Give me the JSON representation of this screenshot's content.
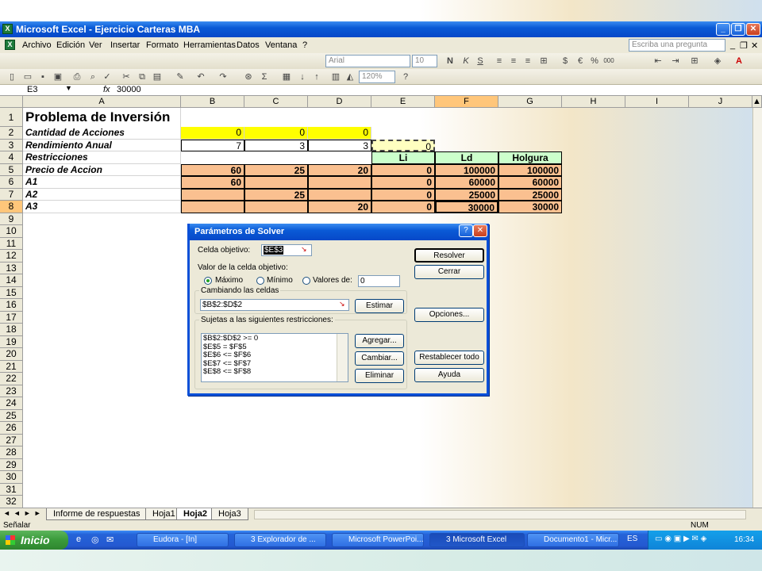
{
  "window": {
    "title": "Microsoft Excel - Ejercicio Carteras MBA"
  },
  "menu": {
    "items": [
      "Archivo",
      "Edición",
      "Ver",
      "Insertar",
      "Formato",
      "Herramientas",
      "Datos",
      "Ventana",
      "?"
    ],
    "help_placeholder": "Escriba una pregunta"
  },
  "toolbar": {
    "font": "Arial",
    "size": "10",
    "zoom": "120%"
  },
  "formula_bar": {
    "name_box": "E3",
    "fx": "fx",
    "value": "30000"
  },
  "columns": [
    "A",
    "B",
    "C",
    "D",
    "E",
    "F",
    "G",
    "H",
    "I",
    "J"
  ],
  "rows": [
    "1",
    "2",
    "3",
    "4",
    "5",
    "6",
    "7",
    "8",
    "9",
    "10",
    "11",
    "12",
    "13",
    "14",
    "15",
    "16",
    "17",
    "18",
    "19",
    "20",
    "21",
    "22",
    "23",
    "24",
    "25",
    "26",
    "27",
    "28",
    "29",
    "30",
    "31",
    "32"
  ],
  "cells": {
    "title": "Problema de Inversión",
    "r2": {
      "label": "Cantidad de Acciones",
      "b": "0",
      "c": "0",
      "d": "0"
    },
    "r3": {
      "label": "Rendimiento Anual",
      "b": "7",
      "c": "3",
      "d": "3",
      "e": "0"
    },
    "r4": {
      "label": "Restricciones",
      "e": "Li",
      "f": "Ld",
      "g": "Holgura"
    },
    "r5": {
      "label": "Precio de Accion",
      "b": "60",
      "c": "25",
      "d": "20",
      "e": "0",
      "f": "100000",
      "g": "100000"
    },
    "r6": {
      "label": "A1",
      "b": "60",
      "e": "0",
      "f": "60000",
      "g": "60000"
    },
    "r7": {
      "label": "A2",
      "c": "25",
      "e": "0",
      "f": "25000",
      "g": "25000"
    },
    "r8": {
      "label": "A3",
      "d": "20",
      "e": "0",
      "f": "30000",
      "g": "30000"
    }
  },
  "sheet_tabs": [
    "Informe de respuestas",
    "Hoja1",
    "Hoja2",
    "Hoja3"
  ],
  "status": {
    "left": "Señalar",
    "right": "NUM"
  },
  "dialog": {
    "title": "Parámetros de Solver",
    "target_label": "Celda objetivo:",
    "target_value": "$E$3",
    "value_label": "Valor de la celda objetivo:",
    "max": "Máximo",
    "min": "Mínimo",
    "values_of": "Valores de:",
    "values_input": "0",
    "changing_label": "Cambiando las celdas",
    "changing_value": "$B$2:$D$2",
    "subject_label": "Sujetas a las siguientes restricciones:",
    "constraints": [
      "$B$2:$D$2 >= 0",
      "$E$5 = $F$5",
      "$E$6 <= $F$6",
      "$E$7 <= $F$7",
      "$E$8 <= $F$8"
    ],
    "buttons": {
      "solve": "Resolver",
      "close": "Cerrar",
      "guess": "Estimar",
      "options": "Opciones...",
      "add": "Agregar...",
      "change": "Cambiar...",
      "delete": "Eliminar",
      "reset": "Restablecer todo",
      "help": "Ayuda"
    }
  },
  "taskbar": {
    "start": "Inicio",
    "tasks": [
      "Eudora - [In]",
      "3 Explorador de ...",
      "Microsoft PowerPoi...",
      "3 Microsoft Excel",
      "Documento1 - Micr..."
    ],
    "lang": "ES",
    "clock": "16:34"
  }
}
